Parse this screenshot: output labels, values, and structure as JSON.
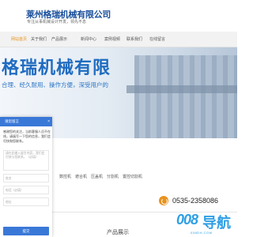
{
  "header": {
    "company_name": "莱州格瑞机械有限公司",
    "tagline": "专注从事机械设计开发，领先不息"
  },
  "nav": {
    "items": [
      {
        "label": "网站首页",
        "active": true
      },
      {
        "label": "关于我们",
        "active": false
      },
      {
        "label": "产品展示",
        "active": false
      },
      {
        "label": "新闻中心",
        "active": false
      },
      {
        "label": "案例视频",
        "active": false
      },
      {
        "label": "联系我们",
        "active": false
      },
      {
        "label": "在线留言",
        "active": false
      }
    ]
  },
  "banner": {
    "title": "格瑞机械有限",
    "slogan": "合理、经久耐用、操作方便，深受用户的"
  },
  "product_links": [
    "数控机",
    "遮合机",
    "压盖机",
    "分割机",
    "置控切割机"
  ],
  "contact": {
    "phone": "0535-2358086",
    "phone_icon": "phone-icon"
  },
  "section": {
    "title": "产品展示"
  },
  "chat": {
    "header": "请您留言",
    "close": "×",
    "message": [
      "感谢您的关注，当前客服人员不在",
      "线，请填写一下您的信息，我们会",
      "尽快和您联系。"
    ],
    "message_placeholder": "请在此输入留言内容，我们会尽快与您联系。（必填）",
    "name_placeholder": "姓名",
    "phone_placeholder": "电话（必填）",
    "address_placeholder": "地址",
    "submit": "提交"
  },
  "watermark": {
    "badge": "008",
    "text": "导航",
    "sub": "008DH.COM"
  }
}
